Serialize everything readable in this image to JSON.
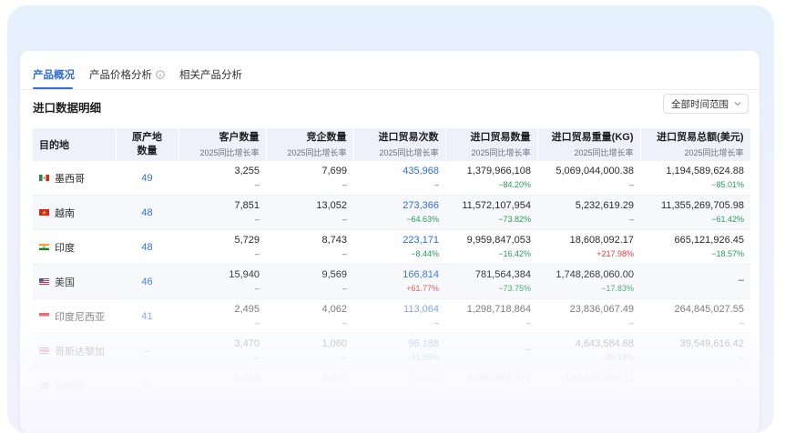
{
  "tabs": {
    "overview": "产品概况",
    "price_analysis": "产品价格分析",
    "related_analysis": "相关产品分析"
  },
  "section": {
    "title": "进口数据明细",
    "time_range": "全部时间范围"
  },
  "table": {
    "headers": {
      "destination": "目的地",
      "origin_line1": "原产地",
      "origin_line2": "数量",
      "customers": "客户数量",
      "competitors": "竞企数量",
      "trade_count": "进口贸易次数",
      "trade_qty": "进口贸易数量",
      "trade_weight": "进口贸易重量(KG)",
      "trade_value": "进口贸易总额(美元)",
      "growth_label": "2025同比增长率"
    },
    "rows": [
      {
        "country": "墨西哥",
        "flag": "mexico-flag",
        "origin": "49",
        "customers": "3,255",
        "customers_g": "–",
        "competitors": "7,699",
        "competitors_g": "–",
        "trades": "435,968",
        "trades_g": "–",
        "qty": "1,379,966,108",
        "qty_g": "−84.20%",
        "weight": "5,069,044,000.38",
        "weight_g": "–",
        "value": "1,194,589,624.88",
        "value_g": "−85.01%"
      },
      {
        "country": "越南",
        "flag": "vietnam-flag",
        "origin": "48",
        "customers": "7,851",
        "customers_g": "–",
        "competitors": "13,052",
        "competitors_g": "–",
        "trades": "273,366",
        "trades_g": "−64.63%",
        "qty": "11,572,107,954",
        "qty_g": "−73.82%",
        "weight": "5,232,619.29",
        "weight_g": "–",
        "value": "11,355,269,705.98",
        "value_g": "−61.42%"
      },
      {
        "country": "印度",
        "flag": "india-flag",
        "origin": "48",
        "customers": "5,729",
        "customers_g": "–",
        "competitors": "8,743",
        "competitors_g": "–",
        "trades": "223,171",
        "trades_g": "−8.44%",
        "qty": "9,959,847,053",
        "qty_g": "−16.42%",
        "weight": "18,608,092.17",
        "weight_g": "+217.98%",
        "value": "665,121,926.45",
        "value_g": "−18.57%"
      },
      {
        "country": "美国",
        "flag": "usa-flag",
        "origin": "46",
        "customers": "15,940",
        "customers_g": "–",
        "competitors": "9,569",
        "competitors_g": "–",
        "trades": "166,814",
        "trades_g": "+61.77%",
        "qty": "781,564,384",
        "qty_g": "−73.75%",
        "weight": "1,748,268,060.00",
        "weight_g": "−17.83%",
        "value": "–",
        "value_g": ""
      },
      {
        "country": "印度尼西亚",
        "flag": "indonesia-flag",
        "origin": "41",
        "customers": "2,495",
        "customers_g": "–",
        "competitors": "4,062",
        "competitors_g": "–",
        "trades": "113,064",
        "trades_g": "–",
        "qty": "1,298,718,864",
        "qty_g": "–",
        "weight": "23,836,067.49",
        "weight_g": "–",
        "value": "264,845,027.55",
        "value_g": "–"
      },
      {
        "country": "哥斯达黎加",
        "flag": "costa-rica-flag",
        "origin": "–",
        "customers": "3,470",
        "customers_g": "–",
        "competitors": "1,060",
        "competitors_g": "–",
        "trades": "96,188",
        "trades_g": "−31.95%",
        "qty": "–",
        "qty_g": "",
        "weight": "4,643,584.68",
        "weight_g": "−49.19%",
        "value": "39,549,616.42",
        "value_g": "–"
      },
      {
        "country": "菲律宾",
        "flag": "philippines-flag",
        "origin": "44",
        "customers": "4,585",
        "customers_g": "–",
        "competitors": "8,611",
        "competitors_g": "–",
        "trades": "74,403",
        "trades_g": "–",
        "qty": "3,390,881,371",
        "qty_g": "–",
        "weight": "196,855,707.11",
        "weight_g": "–",
        "value": "–",
        "value_g": ""
      }
    ]
  },
  "colors": {
    "accent": "#2f6de1",
    "increase": "#e03c3c",
    "decrease": "#25a05a",
    "header_bg": "#eef1fa"
  },
  "icons": [
    "info-icon",
    "chevron-down-icon"
  ]
}
